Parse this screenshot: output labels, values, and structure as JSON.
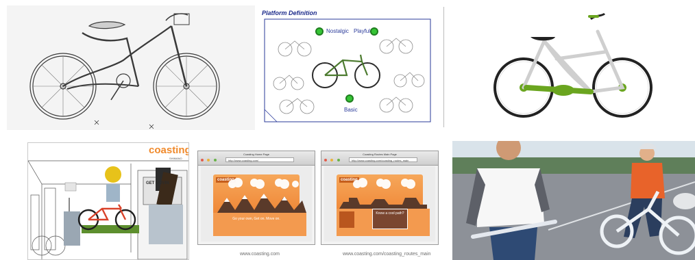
{
  "platform_panel": {
    "title": "Platform Definition",
    "labels": {
      "nostalgic": "Nostalgic",
      "playful": "Playful",
      "basic": "Basic"
    }
  },
  "store_panel": {
    "logo_text": "coasting",
    "logo_sub": "SHIMANO",
    "poster_text": "GET MOVIN"
  },
  "web_panel": {
    "site_logo": "coasting",
    "left": {
      "window_title": "Coasting Home Page",
      "address": "http://www.coasting.com/",
      "hero_text": "Go your own, Get on. Move on.",
      "caption": "www.coasting.com"
    },
    "right": {
      "window_title": "Coasting Routes Main Page",
      "address": "http://www.coasting.com/coasting_routes_main",
      "box_title": "Know a cool path?",
      "caption": "www.coasting.com/coasting_routes_main"
    }
  },
  "colors": {
    "accent_green": "#6aa51f",
    "bike_orange": "#f08a2c",
    "platform_blue": "#1b2a8a",
    "web_orange": "#ef8a3b"
  },
  "icons": [
    "bicycle-sketch-icon",
    "green-marker-icon",
    "bicycle-product-icon",
    "store-display-icon",
    "bicycle-riders-photo-icon"
  ]
}
